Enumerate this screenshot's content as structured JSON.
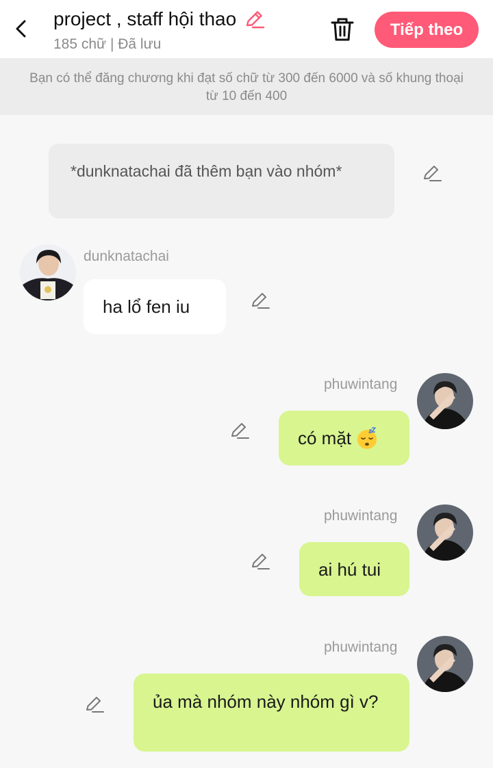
{
  "header": {
    "title": "project , staff hội thao",
    "subtitle": "185 chữ | Đã lưu",
    "next_label": "Tiếp theo",
    "accent_color": "#ff5a77",
    "icons": [
      "chevron-left-icon",
      "pencil-icon",
      "trash-icon"
    ]
  },
  "notice": {
    "text": "Bạn có thể đăng chương khi đạt số chữ từ 300 đến 6000 và số khung thoại từ 10 đến 400"
  },
  "system_message": {
    "text": "*dunknatachai đã thêm bạn vào nhóm*"
  },
  "messages": [
    {
      "sender": "dunknatachai",
      "side": "left",
      "text": "ha lổ fen iu"
    },
    {
      "sender": "phuwintang",
      "side": "right",
      "text": "có mặt",
      "emoji": "sleeping-face"
    },
    {
      "sender": "phuwintang",
      "side": "right",
      "text": "ai hú tui"
    },
    {
      "sender": "phuwintang",
      "side": "right",
      "text": "ủa mà nhóm này nhóm gì v?"
    }
  ],
  "colors": {
    "right_bubble": "#d8f590",
    "left_bubble": "#ffffff",
    "background": "#f7f7f7"
  }
}
